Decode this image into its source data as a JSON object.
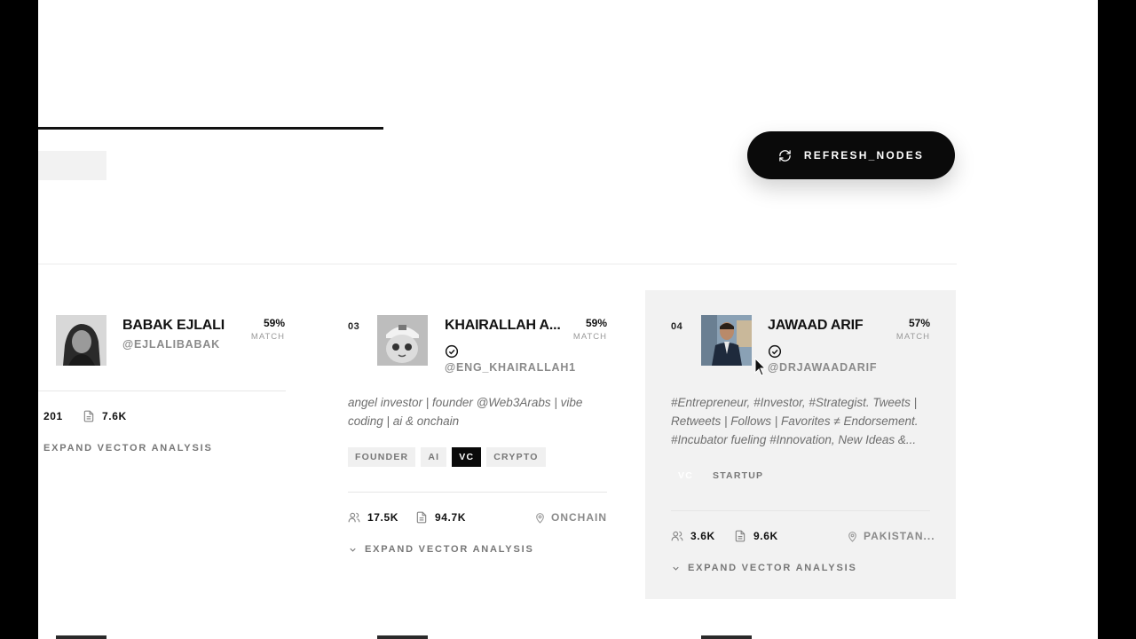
{
  "header": {
    "refresh_label": "REFRESH_NODES"
  },
  "cards": [
    {
      "rank": "",
      "name": "BABAK EJLALI",
      "handle": "@EJLALIBABAK",
      "match_pct": "59%",
      "match_label": "MATCH",
      "verified": false,
      "bio": "",
      "tags": [],
      "followers": "201",
      "posts": "7.6K",
      "location": "",
      "expand_label": "EXPAND VECTOR ANALYSIS"
    },
    {
      "rank": "03",
      "name": "KHAIRALLAH A...",
      "handle": "@ENG_KHAIRALLAH1",
      "match_pct": "59%",
      "match_label": "MATCH",
      "verified": true,
      "bio": "angel investor | founder @Web3Arabs | vibe coding | ai & onchain",
      "tags": [
        {
          "label": "FOUNDER",
          "active": false
        },
        {
          "label": "AI",
          "active": false
        },
        {
          "label": "VC",
          "active": true
        },
        {
          "label": "CRYPTO",
          "active": false
        }
      ],
      "followers": "17.5K",
      "posts": "94.7K",
      "location": "ONCHAIN",
      "expand_label": "EXPAND VECTOR ANALYSIS"
    },
    {
      "rank": "04",
      "name": "JAWAAD ARIF",
      "handle": "@DRJAWAADARIF",
      "match_pct": "57%",
      "match_label": "MATCH",
      "verified": true,
      "bio": "#Entrepreneur, #Investor, #Strategist. Tweets | Retweets | Follows | Favorites ≠ Endorsement. #Incubator fueling #Innovation, New Ideas &...",
      "tags": [
        {
          "label": "VC",
          "active": true
        },
        {
          "label": "STARTUP",
          "active": false
        }
      ],
      "followers": "3.6K",
      "posts": "9.6K",
      "location": "PAKISTAN...",
      "expand_label": "EXPAND VECTOR ANALYSIS"
    }
  ],
  "icons": {
    "refresh": "refresh-icon",
    "verified": "verified-check-icon",
    "followers": "users-icon",
    "posts": "document-icon",
    "location": "map-pin-icon",
    "expand": "chevron-down-icon"
  }
}
